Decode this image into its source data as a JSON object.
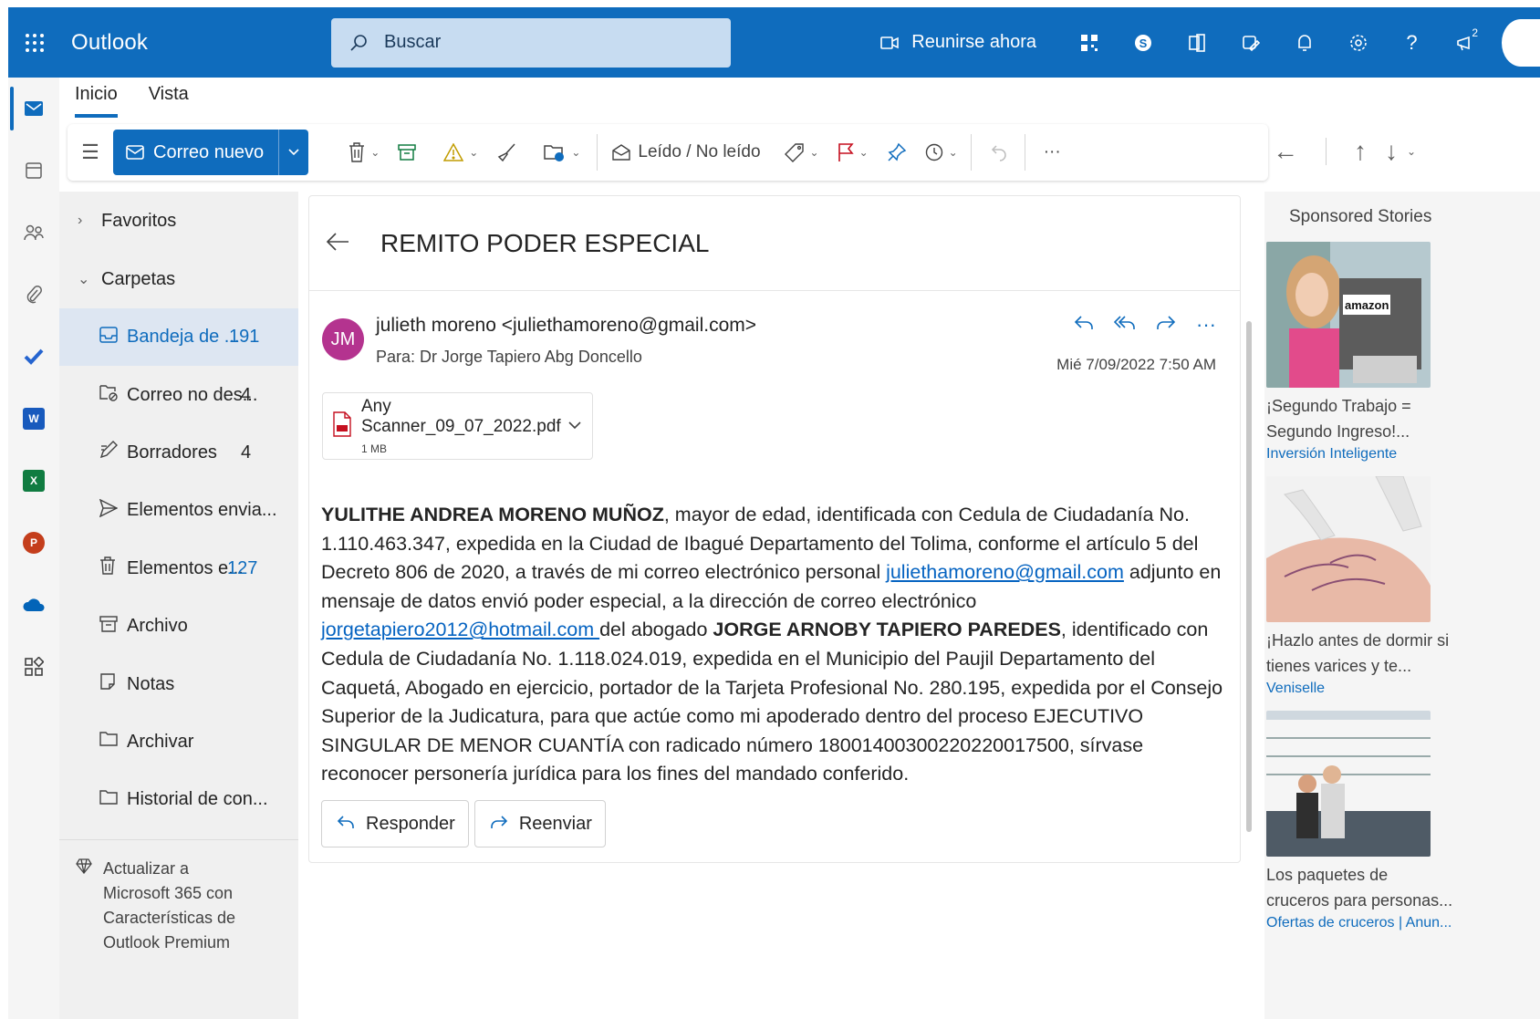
{
  "app": {
    "brand": "Outlook",
    "search_placeholder": "Buscar",
    "meet_now": "Reunirse ahora",
    "notification_count": "2"
  },
  "tabs": [
    {
      "label": "Inicio",
      "active": true
    },
    {
      "label": "Vista",
      "active": false
    }
  ],
  "ribbon": {
    "new_mail": "Correo nuevo",
    "read_unread": "Leído / No leído",
    "more": "···"
  },
  "folders": {
    "favorites": "Favoritos",
    "folders_label": "Carpetas",
    "items": [
      {
        "label": "Bandeja de ...",
        "count": "191",
        "icon": "inbox-icon",
        "active": true
      },
      {
        "label": "Correo no des...",
        "count": "4",
        "icon": "junk-icon",
        "active": false
      },
      {
        "label": "Borradores",
        "count": "4",
        "icon": "drafts-icon",
        "active": false
      },
      {
        "label": "Elementos envia...",
        "count": "",
        "icon": "sent-icon",
        "active": false
      },
      {
        "label": "Elementos e...",
        "count": "127",
        "icon": "deleted-icon",
        "active": false
      },
      {
        "label": "Archivo",
        "count": "",
        "icon": "archive-icon",
        "active": false
      },
      {
        "label": "Notas",
        "count": "",
        "icon": "notes-icon",
        "active": false
      },
      {
        "label": "Archivar",
        "count": "",
        "icon": "folder-icon",
        "active": false
      },
      {
        "label": "Historial de con...",
        "count": "",
        "icon": "folder-icon",
        "active": false
      }
    ],
    "upgrade_text": "Actualizar a Microsoft 365 con Características de Outlook Premium"
  },
  "message": {
    "subject": "REMITO PODER ESPECIAL",
    "avatar_initials": "JM",
    "sender": "julieth moreno <juliethamoreno@gmail.com>",
    "to_label": "Para:",
    "to": "Dr Jorge Tapiero Abg Doncello",
    "date": "Mié 7/09/2022 7:50 AM",
    "attachment": {
      "name": "Any Scanner_09_07_2022.pdf",
      "size": "1 MB"
    },
    "body": {
      "name_bold": "YULITHE ANDREA MORENO MUÑOZ",
      "part1": ", mayor de edad, identificada con Cedula de Ciudadanía No. 1.110.463.347, expedida en la Ciudad de Ibagué Departamento del Tolima, conforme el artículo 5 del Decreto 806 de 2020, a través de mi correo electrónico personal ",
      "email1": "juliethamoreno@gmail.com",
      "part2": " adjunto en mensaje de datos envió poder especial,  a la dirección de correo electrónico ",
      "email2": "jorgetapiero2012@hotmail.com ",
      "part3": "del abogado ",
      "lawyer_bold": "JORGE ARNOBY TAPIERO PAREDES",
      "part4": ", identificado con Cedula de Ciudadanía No. 1.118.024.019, expedida en el Municipio del Paujil Departamento del Caquetá, Abogado en ejercicio, portador de la Tarjeta Profesional No. 280.195, expedida por el Consejo Superior de la Judicatura, para que actúe como mi apoderado dentro del proceso EJECUTIVO SINGULAR DE MENOR CUANTÍA con radicado número 18001400300220220017500, sírvase reconocer personería jurídica para los fines del mandado conferido."
    },
    "reply_label": "Responder",
    "forward_label": "Reenviar"
  },
  "ads": {
    "title": "Sponsored Stories",
    "items": [
      {
        "title_line1": "¡Segundo Trabajo =",
        "title_line2": "Segundo Ingreso!...",
        "source": "Inversión Inteligente",
        "logo_text": "amazon"
      },
      {
        "title_line1": "¡Hazlo antes de dormir si",
        "title_line2": "tienes varices y te...",
        "source": "Veniselle"
      },
      {
        "title_line1": "Los paquetes de",
        "title_line2": "cruceros para personas...",
        "source": "Ofertas de cruceros | Anun..."
      }
    ]
  },
  "colors": {
    "brand_blue": "#0f6cbd",
    "avatar": "#b4338f",
    "link": "#0563c1"
  }
}
